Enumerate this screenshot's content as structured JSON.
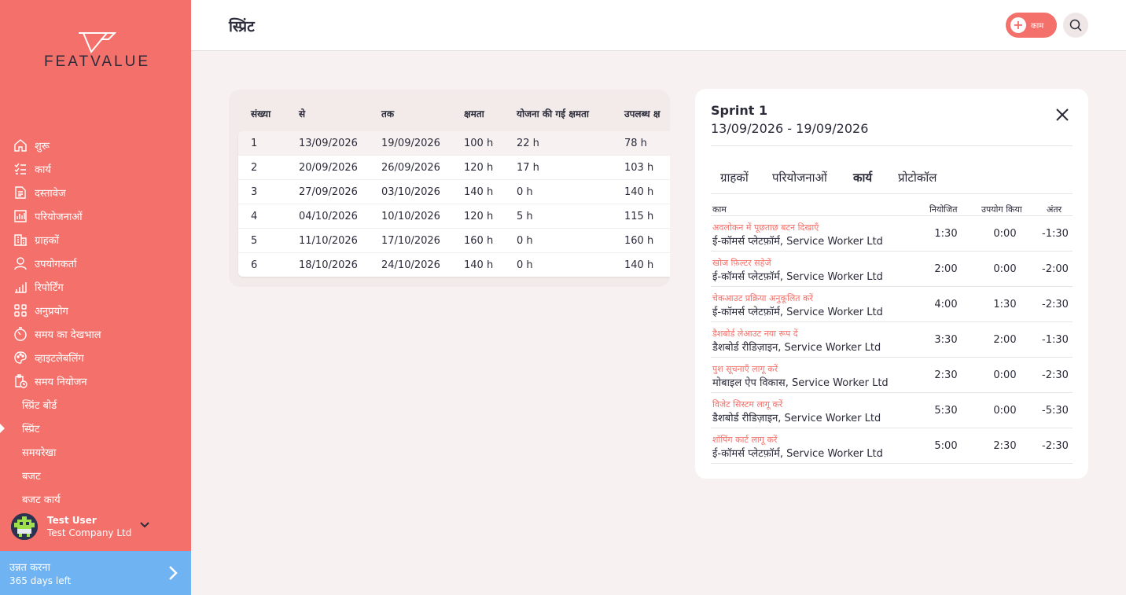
{
  "app": {
    "logo_text": "FEATVALUE"
  },
  "sidebar": {
    "items": [
      {
        "label": "शुरू",
        "icon": "home-icon"
      },
      {
        "label": "कार्य",
        "icon": "task-list-icon"
      },
      {
        "label": "दस्तावेज",
        "icon": "document-icon"
      },
      {
        "label": "परियोजनाओं",
        "icon": "projects-icon"
      },
      {
        "label": "ग्राहकों",
        "icon": "building-icon"
      },
      {
        "label": "उपयोगकर्ता",
        "icon": "user-icon"
      },
      {
        "label": "रिपोर्टिंग",
        "icon": "bar-chart-icon"
      },
      {
        "label": "अनुप्रयोग",
        "icon": "apps-icon"
      },
      {
        "label": "समय का देखभाल",
        "icon": "timer-icon"
      },
      {
        "label": "व्हाइटलेबलिंग",
        "icon": "palette-icon"
      },
      {
        "label": "समय नियोजन",
        "icon": "planner-icon"
      }
    ],
    "sub_items": [
      {
        "label": "स्प्रिंट बोर्ड",
        "active": false
      },
      {
        "label": "स्प्रिंट",
        "active": true
      },
      {
        "label": "समयरेखा",
        "active": false
      },
      {
        "label": "बजट",
        "active": false
      },
      {
        "label": "बजट कार्य",
        "active": false
      }
    ],
    "user": {
      "name": "Test User",
      "company": "Test Company Ltd"
    },
    "upgrade": {
      "title": "उन्नत करना",
      "subtitle": "365 days left"
    }
  },
  "header": {
    "title": "स्प्रिंट",
    "add_label": "काम"
  },
  "sprint_table": {
    "columns": [
      "संख्या",
      "से",
      "तक",
      "क्षमता",
      "योजना की गई क्षमता",
      "उपलब्ध क्ष"
    ],
    "rows": [
      [
        "1",
        "13/09/2026",
        "19/09/2026",
        "100 h",
        "22 h",
        "78 h"
      ],
      [
        "2",
        "20/09/2026",
        "26/09/2026",
        "120 h",
        "17 h",
        "103 h"
      ],
      [
        "3",
        "27/09/2026",
        "03/10/2026",
        "140 h",
        "0 h",
        "140 h"
      ],
      [
        "4",
        "04/10/2026",
        "10/10/2026",
        "120 h",
        "5 h",
        "115 h"
      ],
      [
        "5",
        "11/10/2026",
        "17/10/2026",
        "160 h",
        "0 h",
        "160 h"
      ],
      [
        "6",
        "18/10/2026",
        "24/10/2026",
        "140 h",
        "0 h",
        "140 h"
      ]
    ]
  },
  "detail": {
    "name": "Sprint 1",
    "range": "13/09/2026 - 19/09/2026",
    "tabs": [
      "ग्राहकों",
      "परियोजनाओं",
      "कार्य",
      "प्रोटोकॉल"
    ],
    "active_tab": "कार्य",
    "task_columns": [
      "काम",
      "नियोजित",
      "उपयोग किया",
      "अंतर"
    ],
    "tasks": [
      {
        "title": "अवलोकन में पूछताछ बटन दिखाएँ",
        "project": "ई-कॉमर्स प्लेटफ़ॉर्म, Service Worker Ltd",
        "planned": "1:30",
        "used": "0:00",
        "diff": "-1:30"
      },
      {
        "title": "खोज फ़िल्टर सहेजें",
        "project": "ई-कॉमर्स प्लेटफ़ॉर्म, Service Worker Ltd",
        "planned": "2:00",
        "used": "0:00",
        "diff": "-2:00"
      },
      {
        "title": "चेकआउट प्रक्रिया अनुकूलित करें",
        "project": "ई-कॉमर्स प्लेटफ़ॉर्म, Service Worker Ltd",
        "planned": "4:00",
        "used": "1:30",
        "diff": "-2:30"
      },
      {
        "title": "डैशबोर्ड लेआउट नया रूप दें",
        "project": "डैशबोर्ड रीडिज़ाइन, Service Worker Ltd",
        "planned": "3:30",
        "used": "2:00",
        "diff": "-1:30"
      },
      {
        "title": "पुश सूचनाएँ लागू करें",
        "project": "मोबाइल ऐप विकास, Service Worker Ltd",
        "planned": "2:30",
        "used": "0:00",
        "diff": "-2:30"
      },
      {
        "title": "विजेट सिस्टम लागू करें",
        "project": "डैशबोर्ड रीडिज़ाइन, Service Worker Ltd",
        "planned": "5:30",
        "used": "0:00",
        "diff": "-5:30"
      },
      {
        "title": "शॉपिंग कार्ट लागू करें",
        "project": "ई-कॉमर्स प्लेटफ़ॉर्म, Service Worker Ltd",
        "planned": "5:00",
        "used": "2:30",
        "diff": "-2:30"
      }
    ]
  },
  "colors": {
    "accent": "#f4706a",
    "upgrade": "#6fb3f2",
    "text": "#2b2b3a"
  }
}
